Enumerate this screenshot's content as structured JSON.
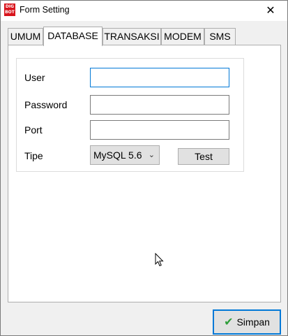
{
  "window": {
    "title": "Form Setting",
    "app_icon_text": "DIG BOT",
    "close_glyph": "✕"
  },
  "tabs": [
    {
      "label": "UMUM",
      "active": false
    },
    {
      "label": "DATABASE",
      "active": true
    },
    {
      "label": "TRANSAKSI",
      "active": false
    },
    {
      "label": "MODEM",
      "active": false
    },
    {
      "label": "SMS",
      "active": false
    }
  ],
  "database": {
    "user": {
      "label": "User",
      "value": ""
    },
    "password": {
      "label": "Password",
      "value": ""
    },
    "port": {
      "label": "Port",
      "value": ""
    },
    "tipe": {
      "label": "Tipe",
      "selected": "MySQL 5.6",
      "chevron": "⌄"
    },
    "test_label": "Test"
  },
  "footer": {
    "save_label": "Simpan",
    "save_icon": "✔"
  },
  "colors": {
    "focus_border": "#0078d7",
    "check_green": "#2e9e3a",
    "app_icon_red": "#d8141c"
  }
}
